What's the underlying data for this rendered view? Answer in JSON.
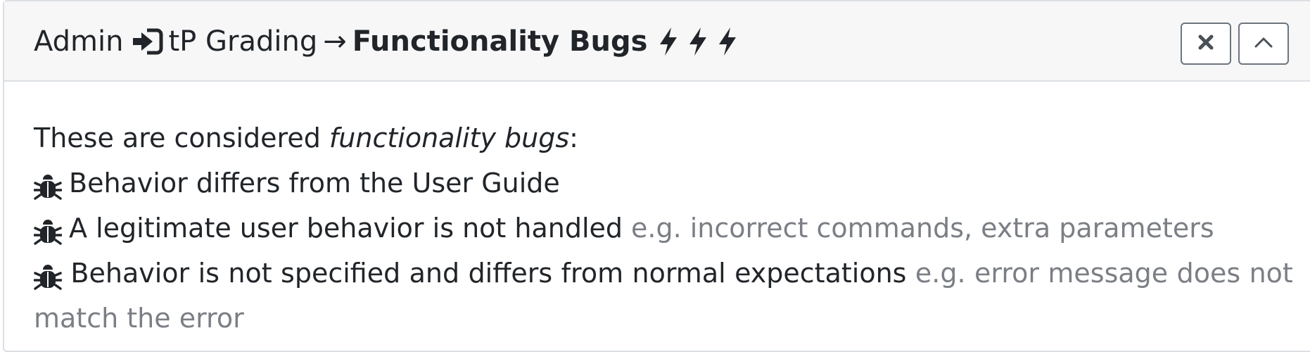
{
  "header": {
    "crumb_admin": "Admin",
    "crumb_icon": "sign-in-icon",
    "crumb_tp": "tP Grading",
    "arrow": "→",
    "section_title": "Functionality Bugs",
    "bolt_icon": "bolt-icon",
    "bolt_count": 3,
    "close_icon": "close-icon",
    "collapse_icon": "chevron-up-icon"
  },
  "body": {
    "intro_before": "These are considered ",
    "intro_em": "functionality bugs",
    "intro_after": ":",
    "bug_icon": "bug-icon",
    "items": [
      {
        "text": "Behavior differs from the User Guide",
        "note": ""
      },
      {
        "text": "A legitimate user behavior is not handled",
        "note": "e.g. incorrect commands, extra parameters"
      },
      {
        "text": "Behavior is not specified and differs from normal expectations",
        "note": "e.g. error message does not match the error"
      }
    ],
    "item3_words": [
      "Behavior",
      "is",
      "not",
      "specified",
      "and",
      "differs",
      "from",
      "normal",
      "expectations"
    ],
    "item3_note_line1_words": [
      "e.g.",
      "error",
      "message",
      "does",
      "not"
    ],
    "item3_note_line2": "match the error"
  },
  "colors": {
    "text": "#212529",
    "muted": "#7b7f85",
    "header_bg": "#f7f7f8",
    "border": "#dcdfe3",
    "button_border": "#6c757d"
  }
}
